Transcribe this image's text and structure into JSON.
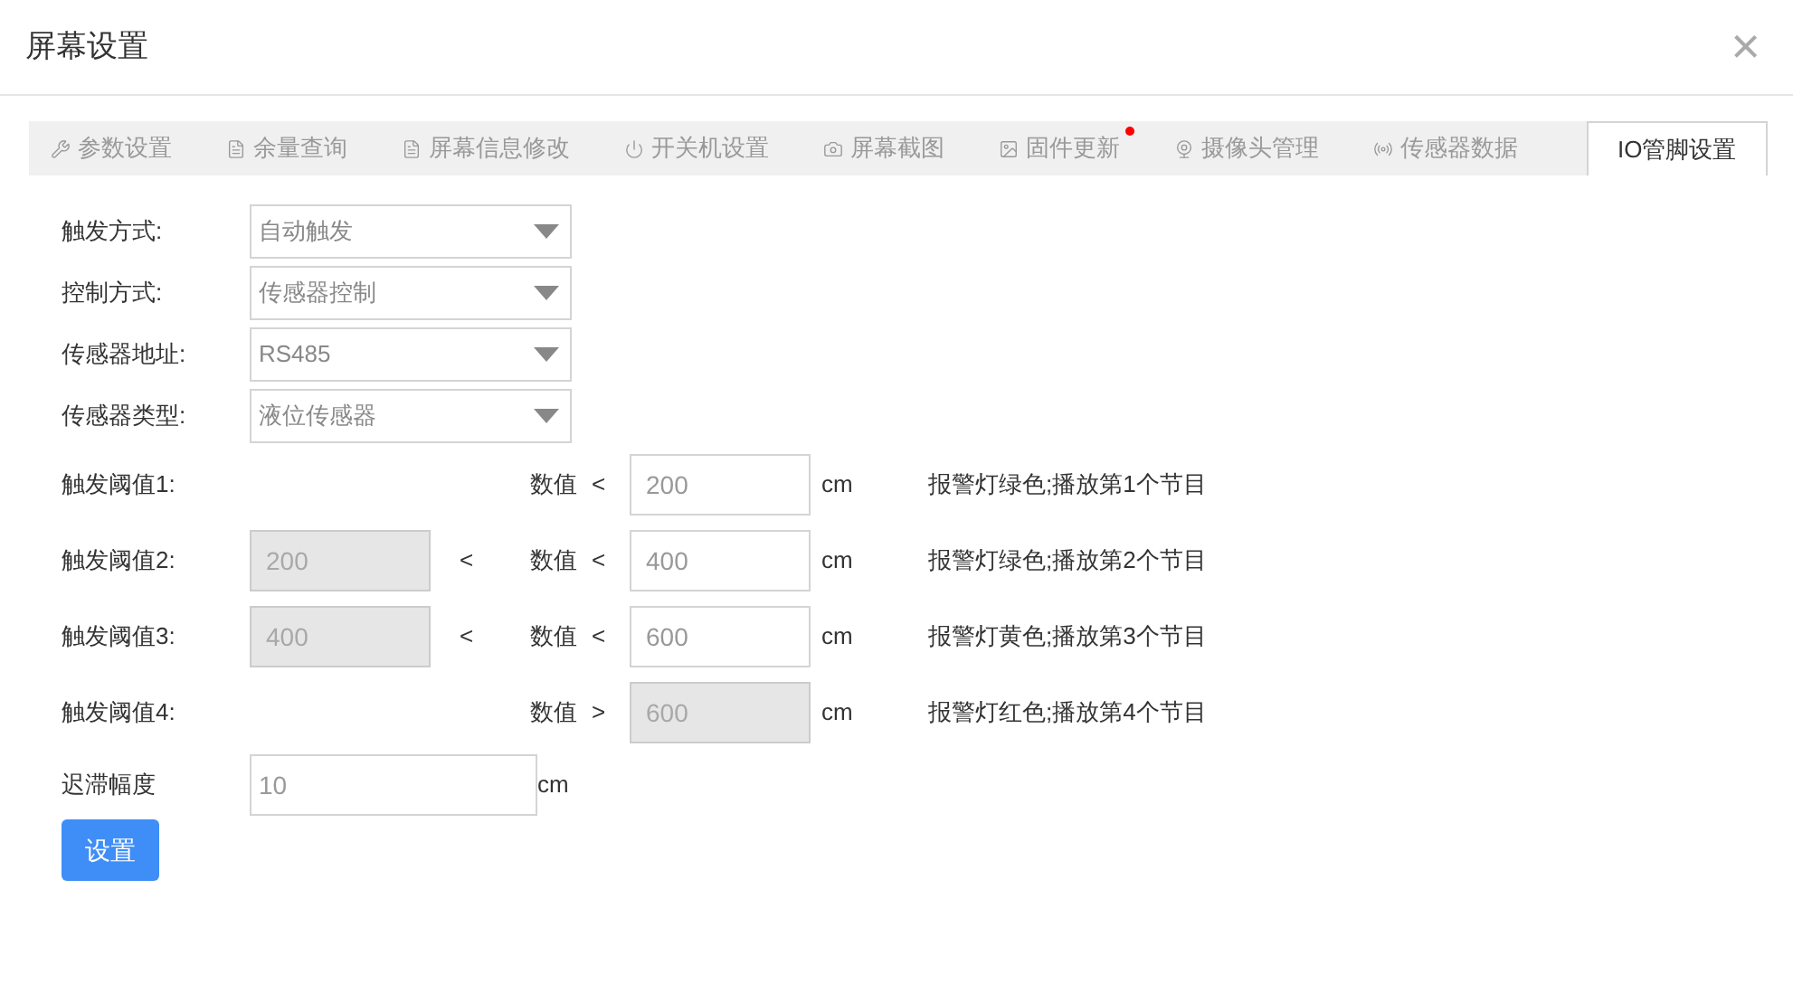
{
  "dialog": {
    "title": "屏幕设置",
    "close": "×"
  },
  "tabs": [
    {
      "label": "参数设置",
      "selected": false,
      "dot": false
    },
    {
      "label": "余量查询",
      "selected": false,
      "dot": false
    },
    {
      "label": "屏幕信息修改",
      "selected": false,
      "dot": false
    },
    {
      "label": "开关机设置",
      "selected": false,
      "dot": false
    },
    {
      "label": "屏幕截图",
      "selected": false,
      "dot": false
    },
    {
      "label": "固件更新",
      "selected": false,
      "dot": true
    },
    {
      "label": "摄像头管理",
      "selected": false,
      "dot": false
    },
    {
      "label": "传感器数据",
      "selected": false,
      "dot": false
    },
    {
      "label": "IO管脚设置",
      "selected": true,
      "dot": false
    }
  ],
  "selects": [
    {
      "label": "触发方式:",
      "value": "自动触发"
    },
    {
      "label": "控制方式:",
      "value": "传感器控制"
    },
    {
      "label": "传感器地址:",
      "value": "RS485"
    },
    {
      "label": "传感器类型:",
      "value": "液位传感器"
    }
  ],
  "thresholds": [
    {
      "label": "触发阈值1:",
      "name": "数值",
      "op": "<",
      "high": {
        "value": "200",
        "disabled": false
      },
      "unit": "cm",
      "note": "报警灯绿色;播放第1个节目"
    },
    {
      "label": "触发阈值2:",
      "low": {
        "value": "200",
        "disabled": true
      },
      "low_op": "<",
      "name": "数值",
      "op": "<",
      "high": {
        "value": "400",
        "disabled": false
      },
      "unit": "cm",
      "note": "报警灯绿色;播放第2个节目"
    },
    {
      "label": "触发阈值3:",
      "low": {
        "value": "400",
        "disabled": true
      },
      "low_op": "<",
      "name": "数值",
      "op": "<",
      "high": {
        "value": "600",
        "disabled": false
      },
      "unit": "cm",
      "note": "报警灯黄色;播放第3个节目"
    },
    {
      "label": "触发阈值4:",
      "name": "数值",
      "op": ">",
      "high": {
        "value": "600",
        "disabled": true
      },
      "unit": "cm",
      "note": "报警灯红色;播放第4个节目"
    }
  ],
  "hysteresis": {
    "label": "迟滞幅度",
    "value": "10",
    "unit": "cm"
  },
  "submit": "设置"
}
